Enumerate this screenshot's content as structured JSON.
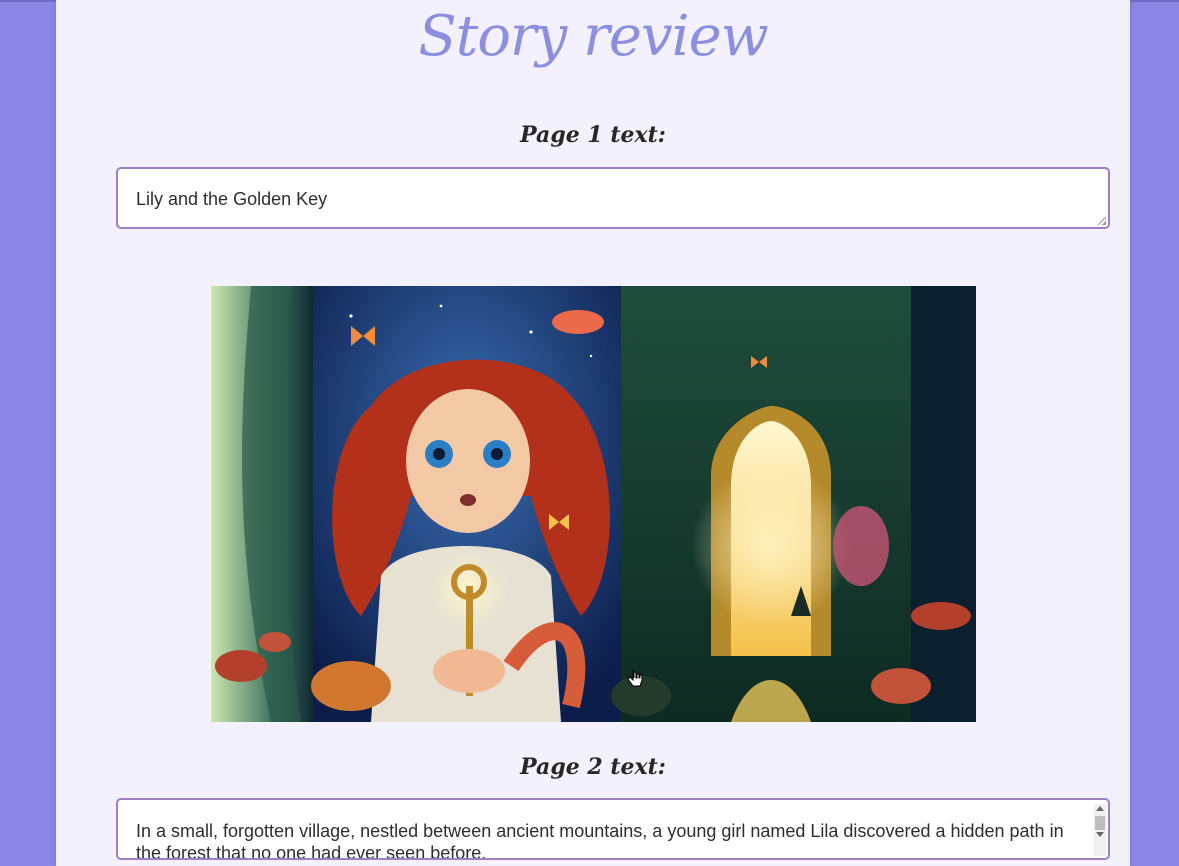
{
  "page": {
    "title": "Story review",
    "page1": {
      "label": "Page 1 text:",
      "text": "Lily and the Golden Key"
    },
    "illustration": {
      "icon": "story-illustration-image"
    },
    "page2": {
      "label": "Page 2 text:",
      "text": "In a small, forgotten village, nestled between ancient mountains, a young girl named Lila discovered a hidden path in the forest that no one had ever seen before."
    }
  },
  "colors": {
    "background": "#8a87e6",
    "panel": "#f2f1fd",
    "title": "#8c8fe0",
    "field_border": "#9d7fc4"
  }
}
